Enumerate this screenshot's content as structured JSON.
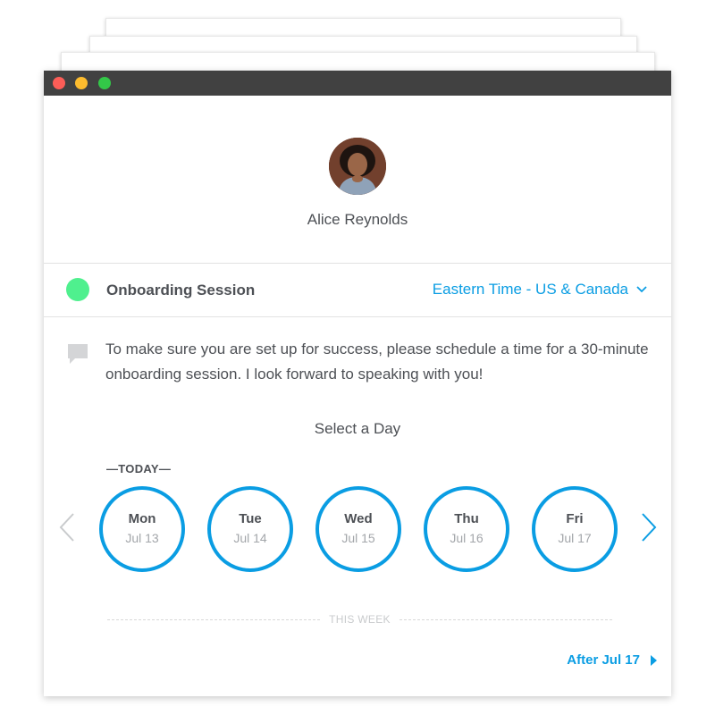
{
  "profile": {
    "name": "Alice Reynolds"
  },
  "event": {
    "title": "Onboarding Session",
    "timezone": "Eastern Time - US & Canada",
    "dot_color": "#4ff08e"
  },
  "description": "To make sure you are set up for success, please schedule a time for a 30-minute onboarding session. I look forward to speaking with you!",
  "calendar": {
    "heading": "Select a Day",
    "today_label": "—TODAY—",
    "days": [
      {
        "name": "Mon",
        "date": "Jul 13"
      },
      {
        "name": "Tue",
        "date": "Jul 14"
      },
      {
        "name": "Wed",
        "date": "Jul 15"
      },
      {
        "name": "Thu",
        "date": "Jul 16"
      },
      {
        "name": "Fri",
        "date": "Jul 17"
      }
    ],
    "week_label": "THIS WEEK",
    "after_label": "After Jul 17"
  },
  "colors": {
    "accent": "#0a9de3",
    "text": "#4d5055",
    "muted": "#a3a6aa"
  },
  "icons": {
    "close": "close-dot-icon",
    "minimize": "minimize-dot-icon",
    "maximize": "maximize-dot-icon",
    "timezone": "chevron-down-icon",
    "description": "speech-bubble-icon",
    "prev": "chevron-left-icon",
    "next": "chevron-right-icon",
    "after": "triangle-right-icon"
  }
}
